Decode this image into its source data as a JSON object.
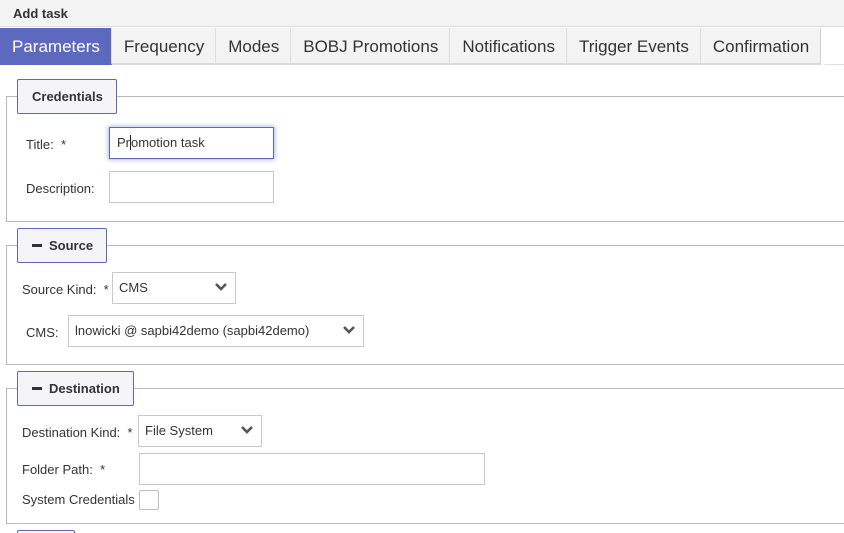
{
  "window": {
    "title": "Add task"
  },
  "tabs": [
    {
      "label": "Parameters",
      "active": true
    },
    {
      "label": "Frequency",
      "active": false
    },
    {
      "label": "Modes",
      "active": false
    },
    {
      "label": "BOBJ Promotions",
      "active": false
    },
    {
      "label": "Notifications",
      "active": false
    },
    {
      "label": "Trigger Events",
      "active": false
    },
    {
      "label": "Confirmation",
      "active": false
    }
  ],
  "credentials": {
    "legend": "Credentials",
    "title_label": "Title:",
    "title_required": "*",
    "title_value_before_caret": "Pr",
    "title_value_after_caret": "omotion task",
    "description_label": "Description:",
    "description_value": ""
  },
  "source": {
    "legend": "Source",
    "collapse_icon": "minus-icon",
    "kind_label": "Source Kind:",
    "kind_required": "*",
    "kind_value": "CMS",
    "cms_label": "CMS:",
    "cms_value": "lnowicki @ sapbi42demo (sapbi42demo)"
  },
  "destination": {
    "legend": "Destination",
    "collapse_icon": "minus-icon",
    "kind_label": "Destination Kind:",
    "kind_required": "*",
    "kind_value": "File System",
    "folder_label": "Folder Path:",
    "folder_required": "*",
    "folder_value": "",
    "system_credentials_label": "System Credentials",
    "system_credentials_checked": false
  },
  "colors": {
    "accent": "#5c69bf",
    "tab_bg": "#f3f3f3",
    "border": "#b9b9b9"
  }
}
